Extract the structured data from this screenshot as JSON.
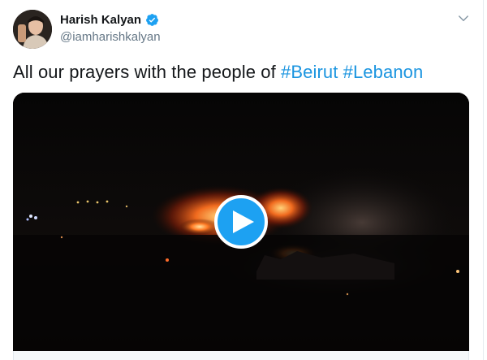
{
  "author": {
    "display_name": "Harish Kalyan",
    "handle": "@iamharishkalyan",
    "verified": true,
    "avatar_icon": "profile-photo"
  },
  "tweet": {
    "text_prefix": "All our prayers with the people of ",
    "hashtags": [
      "#Beirut",
      "#Lebanon"
    ]
  },
  "media": {
    "type": "video",
    "play_icon": "play-icon"
  },
  "colors": {
    "accent": "#1da1f2",
    "hashtag": "#1b95e0",
    "text": "#14171a",
    "muted": "#657786"
  }
}
